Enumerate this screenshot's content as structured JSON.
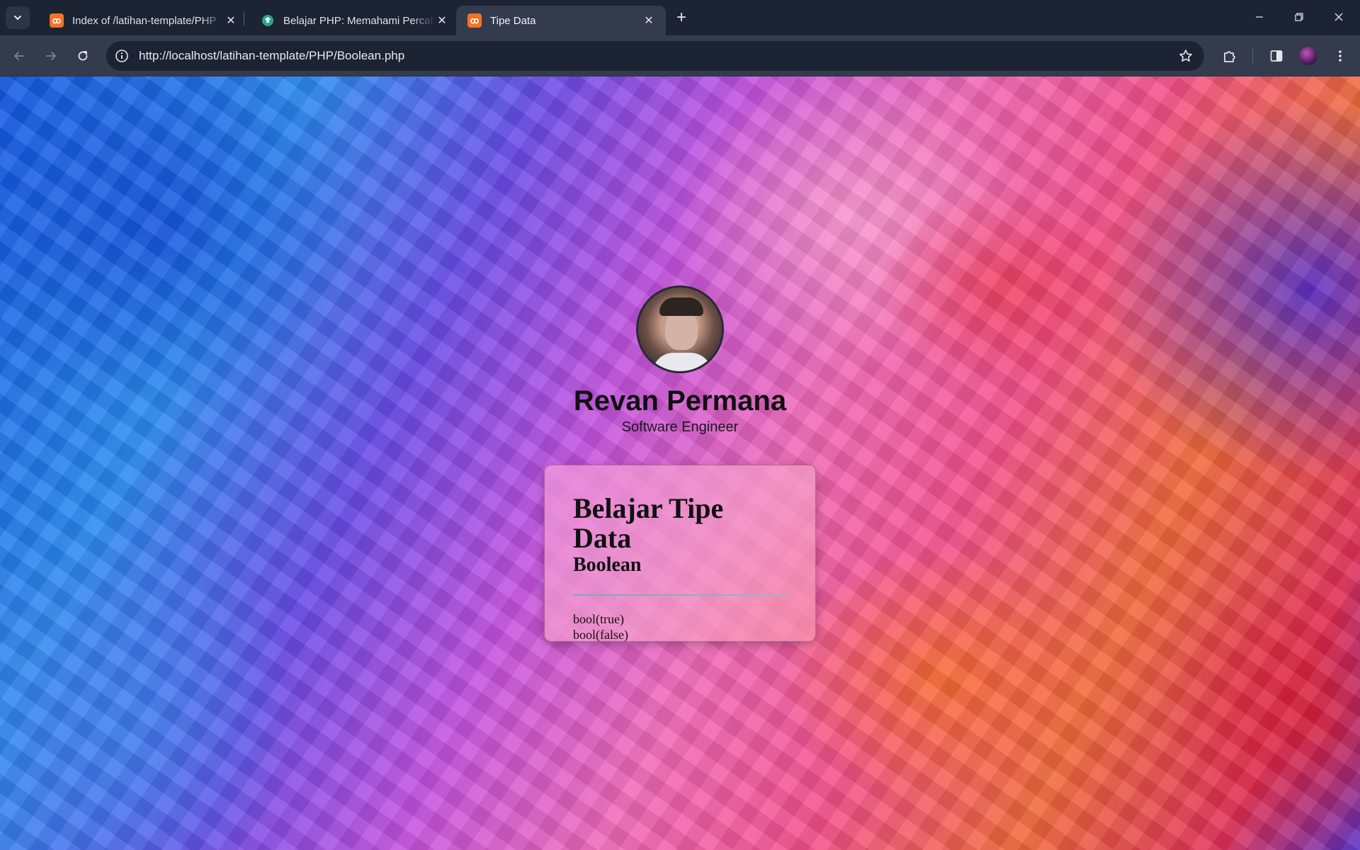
{
  "browser": {
    "tabs": [
      {
        "title": "Index of /latihan-template/PHP",
        "favicon": "xampp-icon",
        "active": false
      },
      {
        "title": "Belajar PHP: Memahami Percabangan",
        "favicon": "site-icon",
        "active": false
      },
      {
        "title": "Tipe Data",
        "favicon": "xampp-icon",
        "active": true
      }
    ],
    "favicon_text": "ꝏ",
    "url": "http://localhost/latihan-template/PHP/Boolean.php",
    "colors": {
      "chrome_bg": "#1c2333",
      "toolbar_bg": "#343b4d",
      "omnibox_bg": "#1c2333",
      "xampp_orange": "#f37325"
    }
  },
  "profile": {
    "name": "Revan Permana",
    "role": "Software Engineer"
  },
  "card": {
    "title": "Belajar Tipe Data",
    "subtitle": "Boolean",
    "lines": [
      "bool(true)",
      "bool(false)"
    ]
  }
}
